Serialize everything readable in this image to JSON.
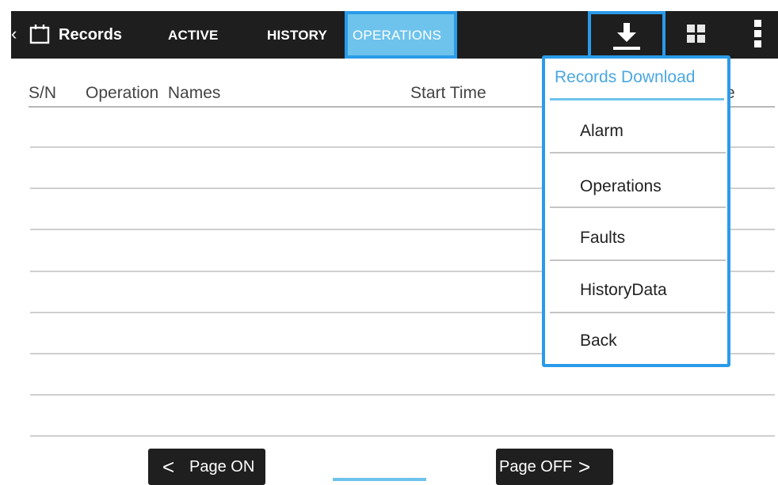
{
  "header": {
    "title": "Records",
    "tabs": [
      {
        "label": "ACTIVE"
      },
      {
        "label": "HISTORY"
      },
      {
        "label": "OPERATIONS",
        "selected": true
      }
    ],
    "icons": {
      "back": "chevron-left-icon",
      "records": "calendar-icon",
      "download": "download-icon",
      "grid": "grid-icon",
      "more": "more-vertical-icon"
    }
  },
  "table": {
    "columns": [
      "S/N",
      "Operation  Names",
      "Start Time",
      "e"
    ],
    "rows": []
  },
  "dropdown": {
    "title": "Records Download",
    "items": [
      "Alarm",
      "Operations",
      "Faults",
      "HistoryData",
      "Back"
    ]
  },
  "pagination": {
    "prev_label": "Page ON",
    "next_label": "Page OFF",
    "prev_glyph": "<",
    "next_glyph": ">"
  },
  "colors": {
    "accent": "#2a9be9",
    "accent_light": "#6dc3ec",
    "topbar": "#1e1e1e"
  }
}
